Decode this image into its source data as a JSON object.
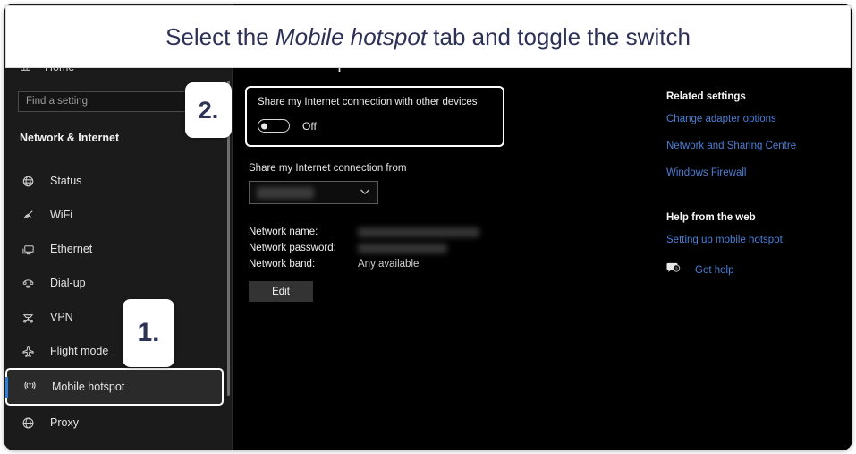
{
  "banner": {
    "text_before": "Select the ",
    "emphasis": "Mobile hotspot",
    "text_after": " tab and toggle the switch"
  },
  "callouts": [
    {
      "name": "step-2",
      "label": "2."
    },
    {
      "name": "step-1",
      "label": "1."
    }
  ],
  "sidebar": {
    "home_label": "Home",
    "home_icon": "home-icon",
    "search_placeholder": "Find a setting",
    "search_value": "",
    "search_icon": "search-icon",
    "section_title": "Network & Internet",
    "items": [
      {
        "label": "Status",
        "icon": "globe-status-icon",
        "selected": false
      },
      {
        "label": "WiFi",
        "icon": "wifi-icon",
        "selected": false
      },
      {
        "label": "Ethernet",
        "icon": "monitor-icon",
        "selected": false
      },
      {
        "label": "Dial-up",
        "icon": "telephone-icon",
        "selected": false
      },
      {
        "label": "VPN",
        "icon": "vpn-network-icon",
        "selected": false
      },
      {
        "label": "Flight mode",
        "icon": "airplane-icon",
        "selected": false
      },
      {
        "label": "Mobile hotspot",
        "icon": "broadcast-icon",
        "selected": true
      },
      {
        "label": "Proxy",
        "icon": "globe-icon",
        "selected": false
      }
    ]
  },
  "main": {
    "heading": "Mobile hotspot",
    "share_toggle": {
      "label": "Share my Internet connection with other devices",
      "state": "Off"
    },
    "share_from": {
      "label": "Share my Internet connection from",
      "value": "",
      "chevron_icon": "chevron-down-icon"
    },
    "details": [
      {
        "key": "Network name:",
        "value": "",
        "blurred": true
      },
      {
        "key": "Network password:",
        "value": "",
        "blurred": true
      },
      {
        "key": "Network band:",
        "value": "Any available",
        "blurred": false
      }
    ],
    "edit_button": "Edit"
  },
  "related": {
    "heading": "Related settings",
    "links": [
      "Change adapter options",
      "Network and Sharing Centre",
      "Windows Firewall"
    ],
    "help_heading": "Help from the web",
    "help_links": [
      "Setting up mobile hotspot"
    ],
    "get_help": {
      "label": "Get help",
      "icon": "help-bubble-icon"
    }
  },
  "colors": {
    "accent_blue": "#2f7fd8",
    "link_blue": "#4c7fd4",
    "badge_navy": "#2e3356",
    "sidebar_bg": "#1b1b1b",
    "main_bg": "#000000",
    "highlight_border": "#ffffff"
  }
}
